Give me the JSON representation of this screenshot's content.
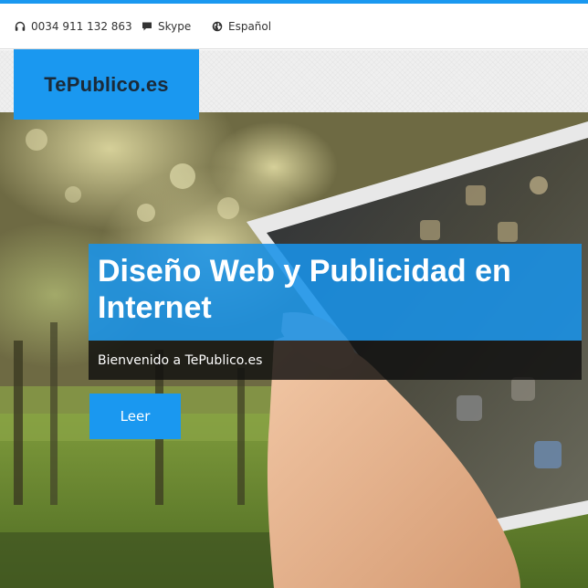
{
  "topbar": {
    "phone": {
      "icon": "headphones-icon",
      "text": "0034 911 132 863"
    },
    "skype": {
      "icon": "chat-bubble-icon",
      "text": "Skype"
    },
    "language": {
      "icon": "globe-icon",
      "text": "Español"
    }
  },
  "brand": {
    "name": "TePublico.es"
  },
  "hero": {
    "title": "Diseño Web y Publicidad en Internet",
    "subtitle": "Bienvenido a TePublico.es",
    "button_label": "Leer"
  },
  "colors": {
    "accent": "#1a98f0",
    "logo_text": "#1b2a38",
    "subtitle_band": "#0f0f0f"
  }
}
